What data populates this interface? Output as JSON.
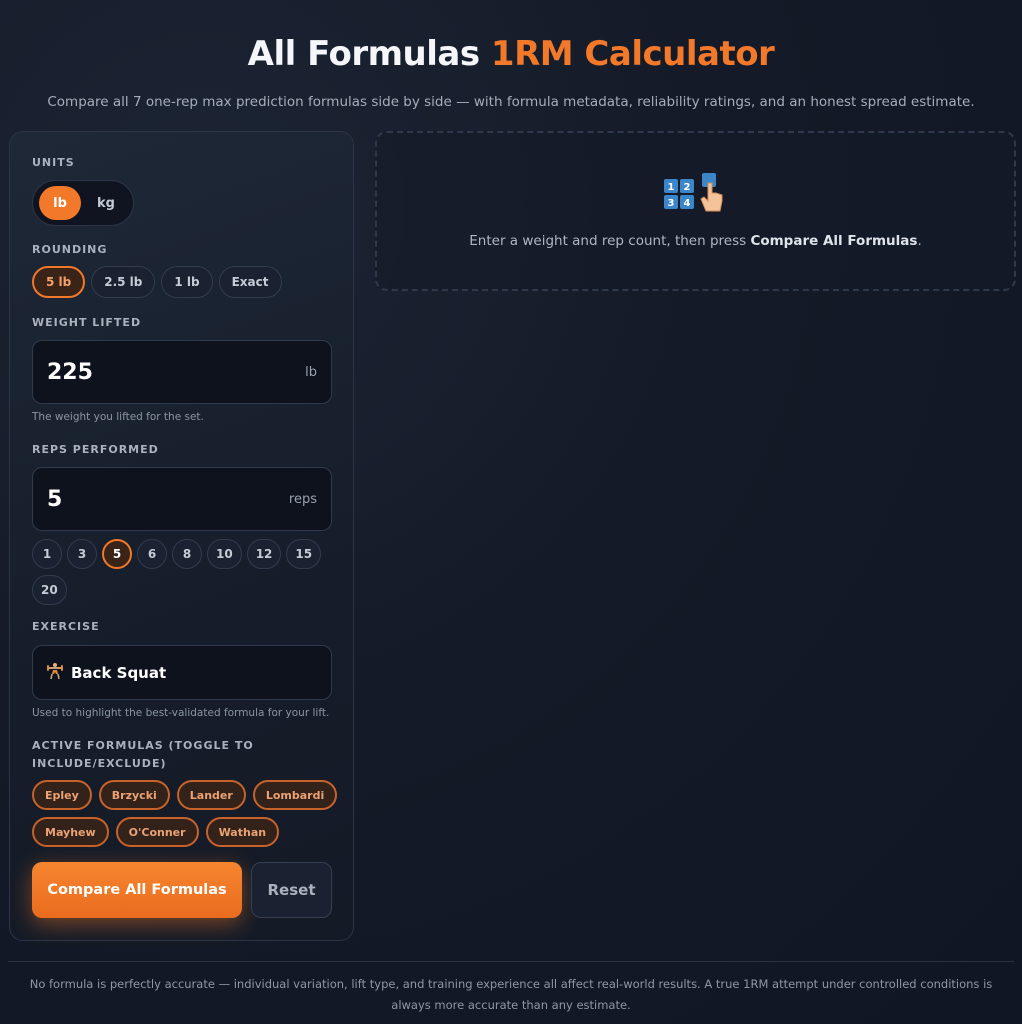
{
  "header": {
    "title_main": "All Formulas",
    "title_accent": "1RM Calculator",
    "subtitle": "Compare all 7 one-rep max prediction formulas side by side — with formula metadata, reliability ratings, and an honest spread estimate."
  },
  "form": {
    "units_label": "UNITS",
    "units": [
      {
        "label": "lb",
        "active": true
      },
      {
        "label": "kg",
        "active": false
      }
    ],
    "rounding_label": "ROUNDING",
    "rounding": [
      {
        "label": "5 lb",
        "active": true
      },
      {
        "label": "2.5 lb",
        "active": false
      },
      {
        "label": "1 lb",
        "active": false
      },
      {
        "label": "Exact",
        "active": false
      }
    ],
    "weight_label": "WEIGHT LIFTED",
    "weight_value": "225",
    "weight_unit": "lb",
    "weight_hint": "The weight you lifted for the set.",
    "reps_label": "REPS PERFORMED",
    "reps_value": "5",
    "reps_unit": "reps",
    "rep_options": [
      {
        "label": "1"
      },
      {
        "label": "3"
      },
      {
        "label": "5",
        "active": true
      },
      {
        "label": "6"
      },
      {
        "label": "8"
      },
      {
        "label": "10"
      },
      {
        "label": "12"
      },
      {
        "label": "15"
      },
      {
        "label": "20"
      }
    ],
    "exercise_label": "EXERCISE",
    "exercise_icon": "weightlifter-icon",
    "exercise_value": "Back Squat",
    "exercise_hint": "Used to highlight the best-validated formula for your lift.",
    "formulas_label": "ACTIVE FORMULAS (TOGGLE TO INCLUDE/EXCLUDE)",
    "formulas": [
      "Epley",
      "Brzycki",
      "Lander",
      "Lombardi",
      "Mayhew",
      "O'Conner",
      "Wathan"
    ],
    "compare_button": "Compare All Formulas",
    "reset_button": "Reset"
  },
  "results": {
    "icon": "numbers-keypad-pointer-icon",
    "prompt_prefix": "Enter a weight and rep count, then press ",
    "prompt_strong": "Compare All Formulas",
    "prompt_suffix": "."
  },
  "footer": {
    "disclaimer": "No formula is perfectly accurate — individual variation, lift type, and training experience all affect real-world results. A true 1RM attempt under controlled conditions is always more accurate than any estimate."
  },
  "colors": {
    "accent": "#f2782a",
    "background": "#141a27",
    "panel": "#1a2231"
  }
}
